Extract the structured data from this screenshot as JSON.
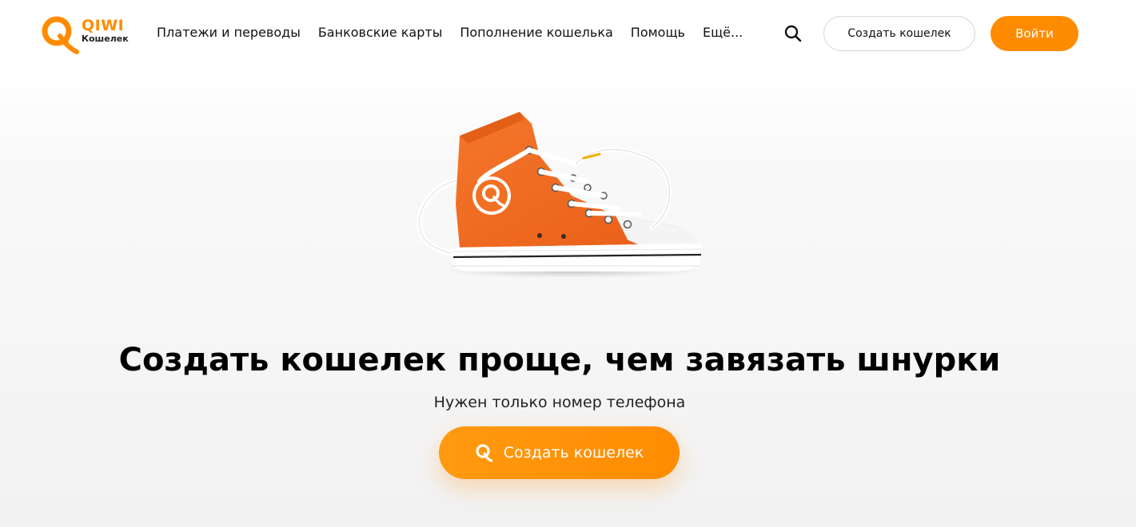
{
  "header": {
    "logo": {
      "brand": "QIWI",
      "subtitle": "Кошелек"
    },
    "nav": [
      {
        "label": "Платежи и переводы"
      },
      {
        "label": "Банковские карты"
      },
      {
        "label": "Пополнение кошелька"
      },
      {
        "label": "Помощь"
      },
      {
        "label": "Ещё..."
      }
    ],
    "search_icon": "search-icon",
    "create_wallet_label": "Создать кошелек",
    "login_label": "Войти"
  },
  "hero": {
    "image": "orange-sneaker-with-qiwi-logo",
    "title": "Создать кошелек проще, чем завязать шнурки",
    "subtitle": "Нужен только номер телефона",
    "cta_label": "Создать кошелек",
    "cta_icon": "qiwi-q-icon"
  },
  "colors": {
    "accent": "#ff8c00",
    "text": "#111111",
    "background": "#f2f2f2"
  }
}
